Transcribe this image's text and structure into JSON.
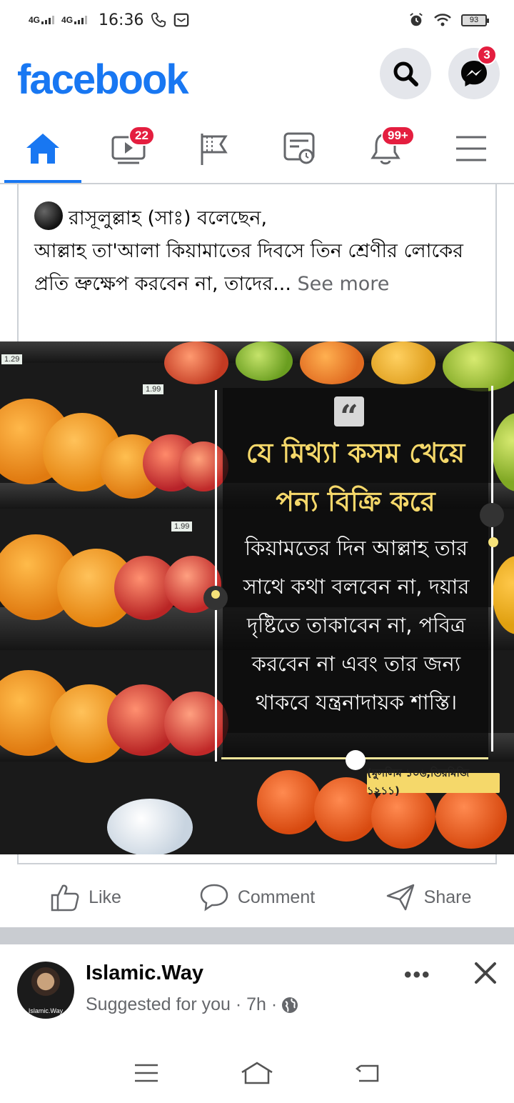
{
  "status_bar": {
    "net1": "4G",
    "net2": "4G",
    "time": "16:36",
    "battery": "93",
    "icons": [
      "phone-icon",
      "voicemail-icon",
      "alarm-icon",
      "wifi-icon"
    ]
  },
  "header": {
    "logo": "facebook",
    "messenger_badge": "3",
    "brand_color": "#1877f2",
    "badge_color": "#e41e3f"
  },
  "nav": {
    "tabs": [
      {
        "name": "home",
        "icon": "home-icon",
        "active": true
      },
      {
        "name": "watch",
        "icon": "video-icon",
        "badge": "22"
      },
      {
        "name": "pages",
        "icon": "flag-icon"
      },
      {
        "name": "feeds",
        "icon": "news-feed-icon"
      },
      {
        "name": "notifications",
        "icon": "bell-icon",
        "badge": "99+"
      },
      {
        "name": "menu",
        "icon": "hamburger-icon"
      }
    ]
  },
  "post": {
    "line1": "রাসূলুল্লাহ (সাঃ) বলেছেন,",
    "body": "আল্লাহ তা'আলা কিয়ামাতের দিবসে তিন শ্রেণীর লোকের প্রতি ভ্রুক্ষেপ করবেন না, তাদের...",
    "see_more": "See more",
    "image": {
      "quote_head_1": "যে মিথ্যা কসম খেয়ে",
      "quote_head_2": "পন্য বিক্রি করে",
      "quote_body": "কিয়ামতের দিন আল্লাহ তার সাথে কথা বলবেন না, দয়ার দৃষ্টিতে তাকাবেন না, পবিত্র করবেন না এবং তার জন্য থাকবে যন্ত্রনাদায়ক শাস্তি।",
      "citation": "(মুসলিম ১০৬,তিরমিজি ১২১১)",
      "price_tags": [
        "1.29",
        "1.99",
        "1.99"
      ]
    },
    "actions": {
      "like": "Like",
      "comment": "Comment",
      "share": "Share"
    }
  },
  "next_post": {
    "page_name": "Islamic.Way",
    "avatar_label": "Islamic.Way",
    "meta": "Suggested for you · 7h ·",
    "more": "•••"
  }
}
